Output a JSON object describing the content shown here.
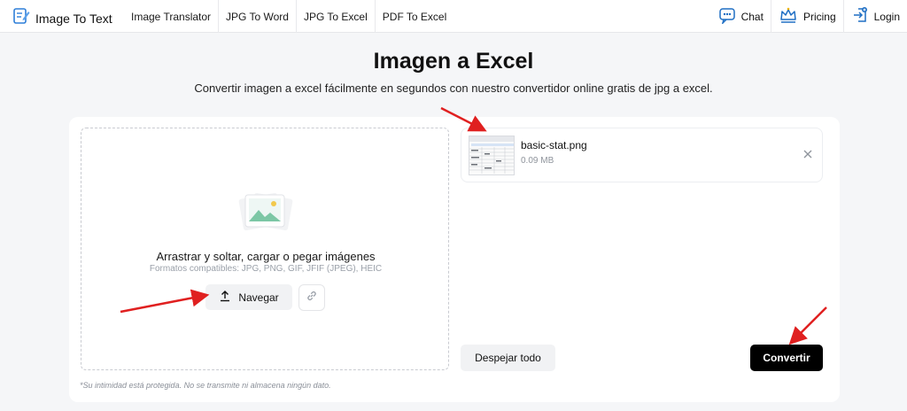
{
  "nav": {
    "brand": "Image To Text",
    "links": [
      "Image Translator",
      "JPG To Word",
      "JPG To Excel",
      "PDF To Excel"
    ],
    "chat": "Chat",
    "pricing": "Pricing",
    "login": "Login"
  },
  "hero": {
    "title": "Imagen a Excel",
    "subtitle": "Convertir imagen a excel fácilmente en segundos con nuestro convertidor online gratis de jpg a excel."
  },
  "upload": {
    "main_text": "Arrastrar y soltar, cargar o pegar imágenes",
    "formats": "Formatos compatibles: JPG, PNG, GIF, JFIF (JPEG), HEIC",
    "browse_label": "Navegar",
    "privacy": "*Su intimidad está protegida. No se transmite ni almacena ningún dato."
  },
  "file": {
    "name": "basic-stat.png",
    "size": "0.09 MB"
  },
  "actions": {
    "clear_label": "Despejar todo",
    "convert_label": "Convertir"
  },
  "colors": {
    "accent": "#000000",
    "annotation": "#e02020",
    "brand_blue": "#2f7fd8"
  },
  "icons": [
    "document-pen-icon",
    "chat-bot-icon",
    "crown-icon",
    "login-icon",
    "image-gallery-icon",
    "upload-icon",
    "link-icon",
    "close-icon"
  ]
}
